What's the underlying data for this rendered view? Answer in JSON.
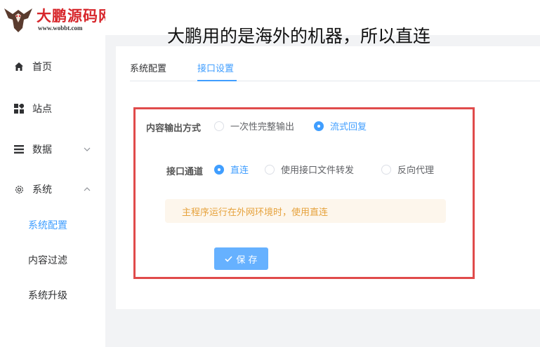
{
  "logo": {
    "brand": "大鹏源码网",
    "url": "www.wobbt.com",
    "icon": "eagle-logo"
  },
  "caption": "大鹏用的是海外的机器，所以直连",
  "sidebar": {
    "items": [
      {
        "label": "首页",
        "icon": "home-icon"
      },
      {
        "label": "站点",
        "icon": "grid-icon"
      },
      {
        "label": "数据",
        "icon": "menu-icon",
        "arrow": "chevron-down-icon"
      },
      {
        "label": "系统",
        "icon": "gear-icon",
        "arrow": "chevron-up-icon"
      }
    ],
    "sub_items": [
      {
        "label": "系统配置",
        "active": true
      },
      {
        "label": "内容过滤",
        "active": false
      },
      {
        "label": "系统升级",
        "active": false
      }
    ]
  },
  "tabs": [
    {
      "label": "系统配置",
      "active": false
    },
    {
      "label": "接口设置",
      "active": true
    }
  ],
  "form": {
    "output_mode": {
      "label": "内容输出方式",
      "options": [
        "一次性完整输出",
        "流式回复"
      ],
      "selected": "流式回复"
    },
    "channel": {
      "label": "接口通道",
      "options": [
        "直连",
        "使用接口文件转发",
        "反向代理"
      ],
      "selected": "直连"
    },
    "alert": "主程序运行在外网环境时，使用直连",
    "save_label": "保 存"
  },
  "colors": {
    "accent": "#409eff",
    "highlight_box": "#e04b4b",
    "warning_text": "#e6a23c",
    "brand": "#d7262b"
  }
}
